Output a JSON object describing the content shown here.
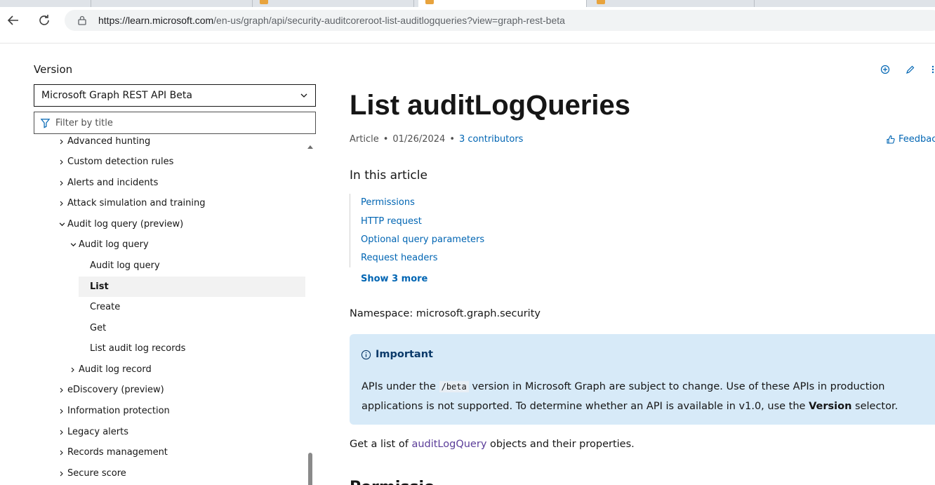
{
  "browser": {
    "url_host": "https://learn.microsoft.com",
    "url_path": "/en-us/graph/api/security-auditcoreroot-list-auditlogqueries?view=graph-rest-beta"
  },
  "sidebar": {
    "version_label": "Version",
    "version_selected": "Microsoft Graph REST API Beta",
    "filter_placeholder": "Filter by title",
    "toc": [
      {
        "label": "Advanced hunting",
        "state": "collapsed"
      },
      {
        "label": "Custom detection rules",
        "state": "collapsed"
      },
      {
        "label": "Alerts and incidents",
        "state": "collapsed"
      },
      {
        "label": "Attack simulation and training",
        "state": "collapsed"
      },
      {
        "label": "Audit log query (preview)",
        "state": "expanded"
      },
      {
        "label": "Audit log query",
        "state": "expanded"
      },
      {
        "label": "Audit log query",
        "state": "leaf"
      },
      {
        "label": "List",
        "state": "selected"
      },
      {
        "label": "Create",
        "state": "leaf"
      },
      {
        "label": "Get",
        "state": "leaf"
      },
      {
        "label": "List audit log records",
        "state": "leaf"
      },
      {
        "label": "Audit log record",
        "state": "collapsed"
      },
      {
        "label": "eDiscovery (preview)",
        "state": "collapsed"
      },
      {
        "label": "Information protection",
        "state": "collapsed"
      },
      {
        "label": "Legacy alerts",
        "state": "collapsed"
      },
      {
        "label": "Records management",
        "state": "collapsed"
      },
      {
        "label": "Secure score",
        "state": "collapsed"
      }
    ]
  },
  "article": {
    "title": "List auditLogQueries",
    "type": "Article",
    "date": "01/26/2024",
    "contributors": "3 contributors",
    "feedback": "Feedback",
    "in_this_article": "In this article",
    "sections": [
      "Permissions",
      "HTTP request",
      "Optional query parameters",
      "Request headers"
    ],
    "show_more": "Show 3 more",
    "namespace": "Namespace: microsoft.graph.security",
    "alert": {
      "title": "Important",
      "body_1": "APIs under the",
      "code": "/beta",
      "body_2": "version in Microsoft Graph are subject to change. Use of these APIs in production applications is not supported. To determine whether an API is available in v1.0, use the",
      "body_bold": "Version",
      "body_3": "selector."
    },
    "desc_1": "Get a list of",
    "desc_link": "auditLogQuery",
    "desc_2": "objects and their properties.",
    "next_heading": "Permissions"
  },
  "colors": {
    "link": "#0065b3",
    "visited_link": "#5b3d99",
    "alert_bg": "#d7eaf8",
    "selected_bg": "#f2f2f2"
  }
}
